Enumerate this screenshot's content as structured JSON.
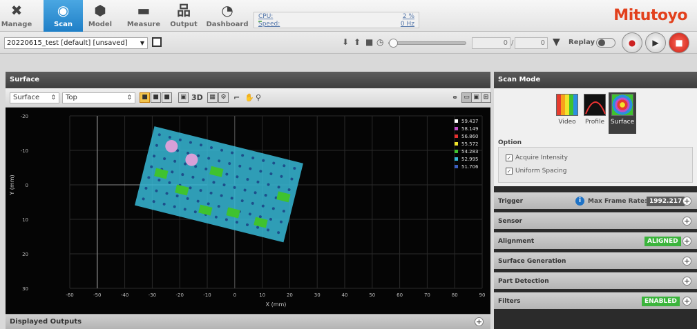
{
  "nav": [
    {
      "label": "Manage",
      "icon": "tools-icon",
      "glyph": "✖",
      "active": false
    },
    {
      "label": "Scan",
      "icon": "scan-icon",
      "glyph": "◉",
      "active": true
    },
    {
      "label": "Model",
      "icon": "model-icon",
      "glyph": "⬢",
      "active": false
    },
    {
      "label": "Measure",
      "icon": "measure-icon",
      "glyph": "▬",
      "active": false
    },
    {
      "label": "Output",
      "icon": "output-icon",
      "glyph": "品",
      "active": false
    },
    {
      "label": "Dashboard",
      "icon": "dashboard-icon",
      "glyph": "◔",
      "active": false
    }
  ],
  "status": {
    "cpu_label": "CPU:",
    "cpu_value": "2 %",
    "cpu_percent": 2,
    "speed_label": "Speed:",
    "speed_value": "0 Hz"
  },
  "brand": {
    "logo_text": "Mitutoyo",
    "color": "#e2401c"
  },
  "job": {
    "file_name": "20220615_test [default] [unsaved]"
  },
  "playback": {
    "frame_current": "0",
    "frame_separator": "/",
    "frame_total": "0",
    "replay_label": "Replay",
    "slider_position": 0
  },
  "surface": {
    "title": "Surface",
    "view_select": "Surface",
    "orientation_select": "Top",
    "tool_3d_label": "3D"
  },
  "chart_data": {
    "type": "heatmap",
    "xlabel": "X (mm)",
    "ylabel": "Y (mm)",
    "xlim": [
      -60,
      90
    ],
    "ylim": [
      30,
      -20
    ],
    "x_ticks": [
      "-60",
      "-50",
      "-40",
      "-30",
      "-20",
      "-10",
      "0",
      "10",
      "20",
      "30",
      "40",
      "50",
      "60",
      "70",
      "80",
      "90"
    ],
    "y_ticks": [
      "-20",
      "-10",
      "0",
      "10",
      "20",
      "30"
    ],
    "y_tick_values": [
      -20,
      -10,
      0,
      10,
      20,
      30
    ],
    "legend": [
      {
        "value": "59.437",
        "color": "#ffffff"
      },
      {
        "value": "58.149",
        "color": "#c04fc7"
      },
      {
        "value": "56.860",
        "color": "#e53030"
      },
      {
        "value": "55.572",
        "color": "#f0e42a"
      },
      {
        "value": "54.283",
        "color": "#3fc22f"
      },
      {
        "value": "52.995",
        "color": "#37b8d6"
      },
      {
        "value": "51.706",
        "color": "#3b5dbf"
      }
    ]
  },
  "outputs": {
    "title": "Displayed Outputs"
  },
  "scan_mode": {
    "title": "Scan Mode",
    "modes": [
      {
        "label": "Video",
        "selected": false
      },
      {
        "label": "Profile",
        "selected": false
      },
      {
        "label": "Surface",
        "selected": true
      }
    ],
    "option_title": "Option",
    "options": [
      {
        "label": "Acquire Intensity",
        "checked": true
      },
      {
        "label": "Uniform Spacing",
        "checked": true
      }
    ]
  },
  "sections": {
    "trigger": {
      "label": "Trigger",
      "max_frame_label": "Max Frame Rate:",
      "max_frame_value": "1992.217"
    },
    "sensor": {
      "label": "Sensor"
    },
    "alignment": {
      "label": "Alignment",
      "badge": "ALIGNED"
    },
    "surface_generation": {
      "label": "Surface Generation"
    },
    "part_detection": {
      "label": "Part Detection"
    },
    "filters": {
      "label": "Filters",
      "badge": "ENABLED"
    }
  }
}
